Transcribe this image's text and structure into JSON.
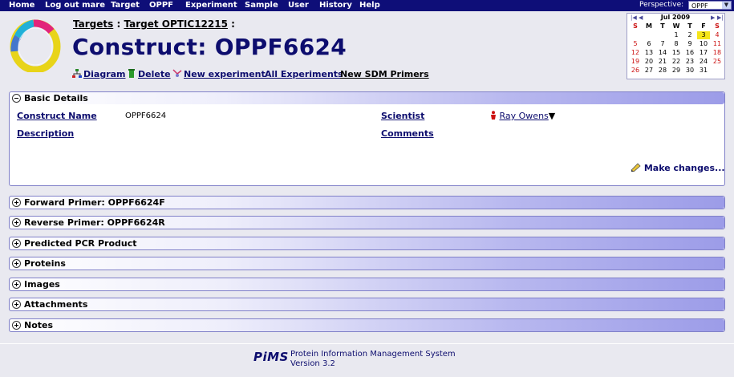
{
  "menu": [
    "Home",
    "Log out mare",
    "Target",
    "OPPF",
    "Experiment",
    "Sample",
    "User",
    "History",
    "Help"
  ],
  "perspective": {
    "label": "Perspective:",
    "value": "OPPF"
  },
  "breadcrumb": {
    "item1": "Targets",
    "sep": ":",
    "item2": "Target OPTIC12215",
    "sep2": ":"
  },
  "title": "Construct: OPPF6624",
  "actions": {
    "diagram": "Diagram",
    "delete": "Delete",
    "new_experiment": "New experiment",
    "all_experiments": "All Experiments",
    "new_sdm": "New SDM Primers"
  },
  "calendar": {
    "title": "Jul 2009",
    "days": [
      "S",
      "M",
      "T",
      "W",
      "T",
      "F",
      "S"
    ],
    "weeks": [
      [
        "",
        "",
        "",
        "1",
        "2",
        "3",
        "4"
      ],
      [
        "5",
        "6",
        "7",
        "8",
        "9",
        "10",
        "11"
      ],
      [
        "12",
        "13",
        "14",
        "15",
        "16",
        "17",
        "18"
      ],
      [
        "19",
        "20",
        "21",
        "22",
        "23",
        "24",
        "25"
      ],
      [
        "26",
        "27",
        "28",
        "29",
        "30",
        "31",
        ""
      ]
    ],
    "today": "3"
  },
  "basic": {
    "title": "Basic Details",
    "construct_name_label": "Construct Name",
    "construct_name_value": "OPPF6624",
    "description_label": "Description",
    "scientist_label": "Scientist",
    "scientist_value": "Ray Owens",
    "comments_label": "Comments",
    "make_changes": "Make changes..."
  },
  "panels": [
    "Forward Primer: OPPF6624F",
    "Reverse Primer: OPPF6624R",
    "Predicted PCR Product",
    "Proteins",
    "Images",
    "Attachments",
    "Notes"
  ],
  "footer": {
    "logo": "PiMS",
    "line1": "Protein Information Management System",
    "line2": "Version 3.2"
  },
  "colors": {
    "menubar": "#0e0e78",
    "title": "#0d0d6e",
    "panel_border": "#8080c8"
  }
}
